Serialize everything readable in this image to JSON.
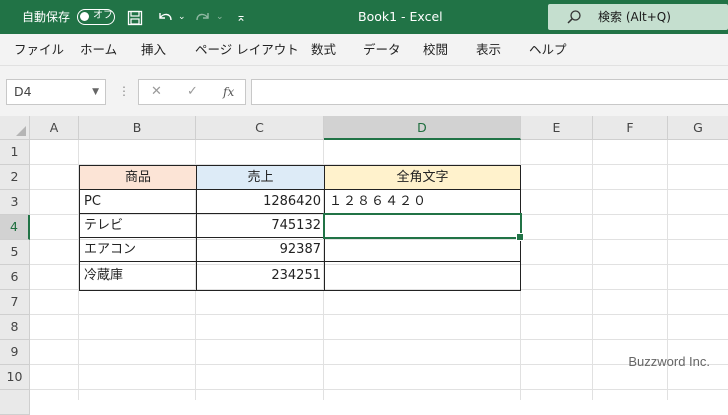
{
  "titlebar": {
    "autosave_label": "自動保存",
    "autosave_state": "オフ",
    "title": "Book1 - Excel",
    "search_placeholder": "検索 (Alt+Q)",
    "accent": "#217346"
  },
  "ribbon_tabs": [
    "ファイル",
    "ホーム",
    "挿入",
    "ページ レイアウト",
    "数式",
    "データ",
    "校閲",
    "表示",
    "ヘルプ"
  ],
  "formula_bar": {
    "name_box": "D4",
    "cancel_icon": "✕",
    "enter_icon": "✓",
    "function_icon": "fx",
    "formula": ""
  },
  "sheet": {
    "columns": [
      "A",
      "B",
      "C",
      "D",
      "E",
      "F",
      "G"
    ],
    "rows": [
      "1",
      "2",
      "3",
      "4",
      "5",
      "6",
      "7",
      "8",
      "9",
      "10"
    ],
    "selected_cell": "D4",
    "headers": {
      "b": "商品",
      "c": "売上",
      "d": "全角文字",
      "b_color": "#fce4d6",
      "c_color": "#ddebf7",
      "d_color": "#fff2cc"
    },
    "data": [
      {
        "product": "PC",
        "sales": "1286420",
        "zenkaku": "１２８６４２０"
      },
      {
        "product": "テレビ",
        "sales": "745132",
        "zenkaku": ""
      },
      {
        "product": "エアコン",
        "sales": "92387",
        "zenkaku": ""
      },
      {
        "product": "冷蔵庫",
        "sales": "234251",
        "zenkaku": ""
      }
    ]
  },
  "watermark": "Buzzword Inc."
}
